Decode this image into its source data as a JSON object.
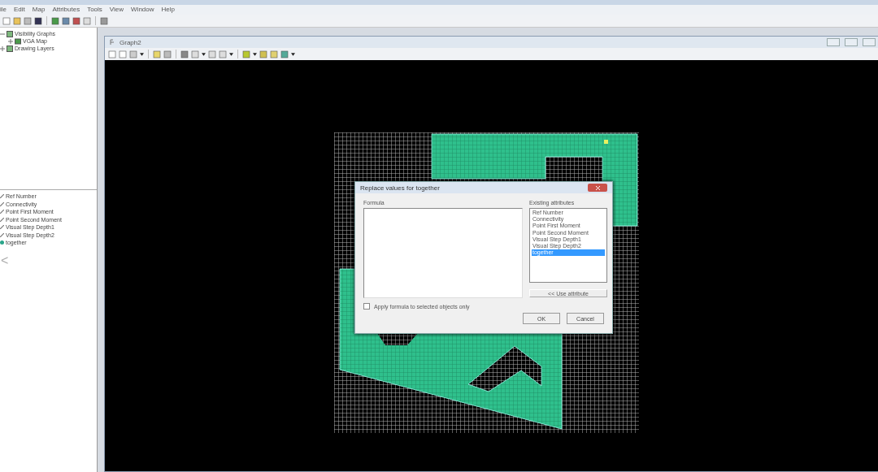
{
  "menu": [
    "ile",
    "Edit",
    "Map",
    "Attributes",
    "Tools",
    "View",
    "Window",
    "Help"
  ],
  "tree": [
    {
      "label": "Visibility Graphs",
      "expanded": true,
      "children": [
        {
          "label": "VGA Map"
        }
      ]
    },
    {
      "label": "Drawing Layers",
      "expanded": false
    }
  ],
  "attributes": [
    {
      "label": "Ref Number",
      "selected": false
    },
    {
      "label": "Connectivity",
      "selected": false
    },
    {
      "label": "Point First Moment",
      "selected": false
    },
    {
      "label": "Point Second Moment",
      "selected": false
    },
    {
      "label": "Visual Step Depth1",
      "selected": false
    },
    {
      "label": "Visual Step Depth2",
      "selected": false
    },
    {
      "label": "together",
      "selected": true
    }
  ],
  "side_arrow": "<",
  "child_window": {
    "title": "Graph2"
  },
  "dialog": {
    "title": "Replace values for together",
    "formula_label": "Formula",
    "existing_label": "Existing attributes",
    "attributes": [
      {
        "label": "Ref Number",
        "selected": false
      },
      {
        "label": "Connectivity",
        "selected": false
      },
      {
        "label": "Point First Moment",
        "selected": false
      },
      {
        "label": "Point Second Moment",
        "selected": false
      },
      {
        "label": "Visual Step Depth1",
        "selected": false
      },
      {
        "label": "Visual Step Depth2",
        "selected": false
      },
      {
        "label": "together",
        "selected": true
      }
    ],
    "use_button": "<< Use attribute",
    "apply_checkbox": {
      "label": "Apply formula to selected objects only",
      "checked": false
    },
    "buttons": [
      "OK",
      "Cancel"
    ]
  }
}
